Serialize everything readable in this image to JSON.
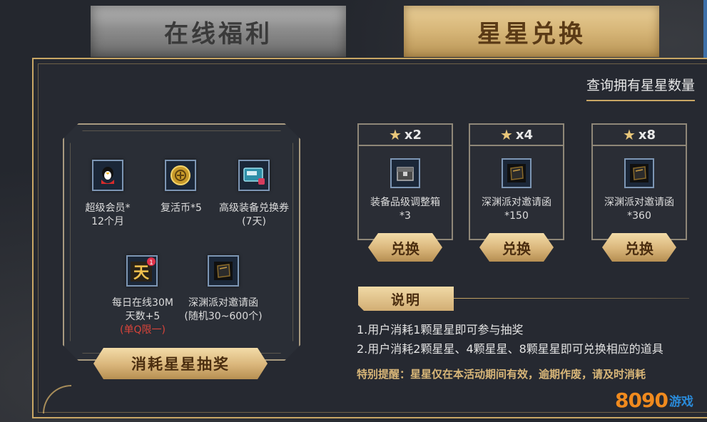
{
  "tabs": {
    "online": "在线福利",
    "star": "星星兑换"
  },
  "query_link": "查询拥有星星数量",
  "lottery": {
    "items": [
      {
        "icon": "qq-penguin-icon",
        "line1": "超级会员*",
        "line2": "12个月"
      },
      {
        "icon": "revive-coin-icon",
        "line1": "复活币*5",
        "line2": ""
      },
      {
        "icon": "equipment-ticket-icon",
        "line1": "高级装备兑换券",
        "line2": "(7天)"
      },
      {
        "icon": "day-badge-icon",
        "line1": "每日在线30M",
        "line2": "天数+5",
        "line3": "(单Q限一)"
      },
      {
        "icon": "abyss-invite-icon",
        "line1": "深渊派对邀请函",
        "line2": "(随机30~600个)"
      }
    ],
    "button": "消耗星星抽奖"
  },
  "cards": [
    {
      "cost": "x2",
      "icon": "equipment-box-icon",
      "line1": "装备品级调整箱",
      "line2": "*3",
      "button": "兑换"
    },
    {
      "cost": "x4",
      "icon": "abyss-invite-icon",
      "line1": "深渊派对邀请函",
      "line2": "*150",
      "button": "兑换"
    },
    {
      "cost": "x8",
      "icon": "abyss-invite-icon",
      "line1": "深渊派对邀请函",
      "line2": "*360",
      "button": "兑换"
    }
  ],
  "notes": {
    "title": "说明",
    "line1": "1.用户消耗1颗星星即可参与抽奖",
    "line2": "2.用户消耗2颗星星、4颗星星、8颗星星即可兑换相应的道具",
    "remind": "特别提醒：星星仅在本活动期间有效，逾期作废，请及时消耗"
  },
  "logo": {
    "num": "8090",
    "text": "游戏"
  },
  "colors": {
    "gold": "#c9a765",
    "accent_red": "#d9443a",
    "icon_border": "#7d96b4"
  }
}
